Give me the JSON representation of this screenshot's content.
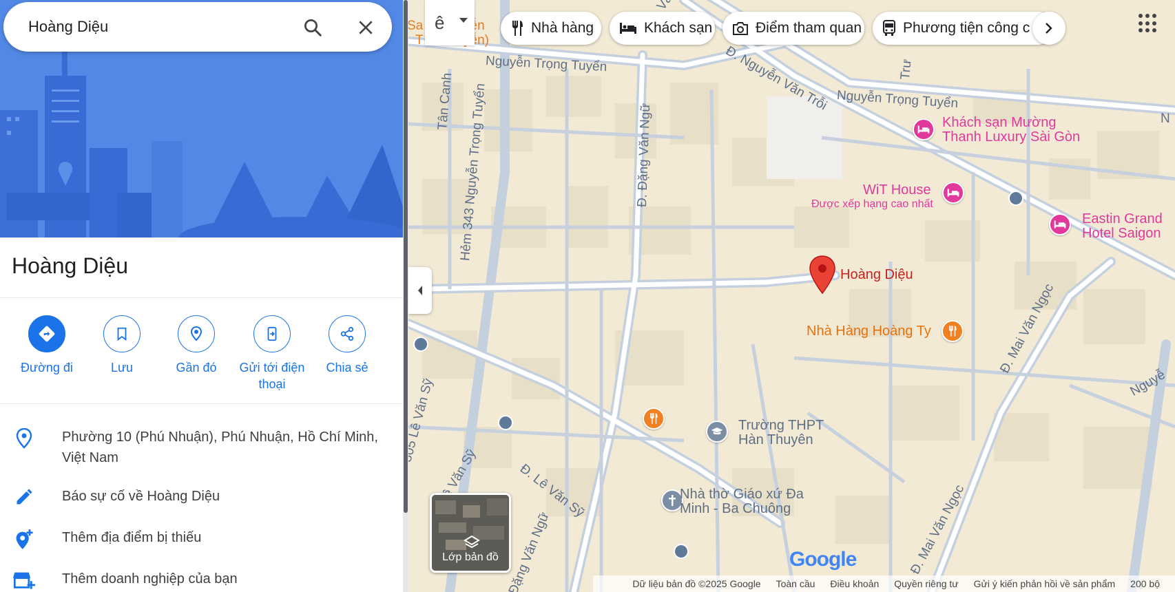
{
  "search": {
    "value": "Hoàng Diệu"
  },
  "place": {
    "title": "Hoàng Diệu",
    "actions": [
      {
        "label": "Đường đi"
      },
      {
        "label": "Lưu"
      },
      {
        "label": "Gần đó"
      },
      {
        "label": "Gửi tới điện thoại"
      },
      {
        "label": "Chia sẻ"
      }
    ],
    "info": {
      "address": "Phường 10 (Phú Nhuận), Phú Nhuận, Hồ Chí Minh, Việt Nam",
      "report": "Báo sự cố về Hoàng Diệu",
      "add_place": "Thêm địa điểm bị thiếu",
      "add_business": "Thêm doanh nghiệp của bạn"
    }
  },
  "map": {
    "chips": [
      {
        "label": "Nhà hàng",
        "icon": "fork-knife-icon"
      },
      {
        "label": "Khách sạn",
        "icon": "bed-icon"
      },
      {
        "label": "Điểm tham quan",
        "icon": "camera-icon"
      },
      {
        "label": "Phương tiện công c",
        "icon": "bus-icon"
      }
    ],
    "pois": {
      "selected": "Hoàng Diệu",
      "restaurant": "Nhà Hàng Hoàng Ty",
      "hotel1_line1": "Khách sạn Mường",
      "hotel1_line2": "Thanh Luxury Sài Gòn",
      "hotel2": "WiT House",
      "hotel2_sub": "Được xếp hạng cao nhất",
      "hotel3_line1": "Eastin Grand",
      "hotel3_line2": "Hotel Saigon",
      "school_line1": "Trường THPT",
      "school_line2": "Hàn Thuyên",
      "church_line1": "Nhà thờ Giáo xứ Đa",
      "church_line2": "Minh - Ba Chuông",
      "top_left_1": "Sa",
      "top_left_2": "yễn",
      "top_left_3": "T",
      "top_left_4": "yễn)"
    },
    "streets": {
      "s1": "Nguyễn Trọng Tuyển",
      "s2": "Nguyễn Trọng Tuyển",
      "s3": "Đ. Nguyễn Văn Trỗi",
      "s4": "Tân Canh",
      "s5": "Hẻm 343 Nguyễn Trọng Tuyển",
      "s6": "Đ. Đặng Văn Ngữ",
      "s7": "Đ. Lê Văn Sỹ",
      "s8": "Lê Văn Sỹ",
      "s9": "305 Lê Văn Sỹ",
      "s10": "Đặng Văn Ngữ",
      "s11": "Đ. Mai Văn Ngọc",
      "s12": "Đ. Mai Văn Ngọc",
      "s13": "Nguyễ",
      "s14": "Trư",
      "s15": "N",
      "s16": "Đ. Văn"
    },
    "layers_label": "Lớp bản đồ",
    "language_glyph": "ê",
    "google_logo": "Google",
    "footer": {
      "data": "Dữ liệu bản đồ ©2025 Google",
      "global": "Toàn cầu",
      "terms": "Điều khoản",
      "privacy": "Quyền riêng tư",
      "feedback": "Gửi ý kiến phản hồi về sản phẩm",
      "scale": "200 bộ"
    }
  },
  "colors": {
    "accent": "#1a73e8",
    "hotel": "#e0399b",
    "restaurant": "#f08020",
    "marker": "#d93025",
    "hero_bg": "#4f86e5"
  }
}
